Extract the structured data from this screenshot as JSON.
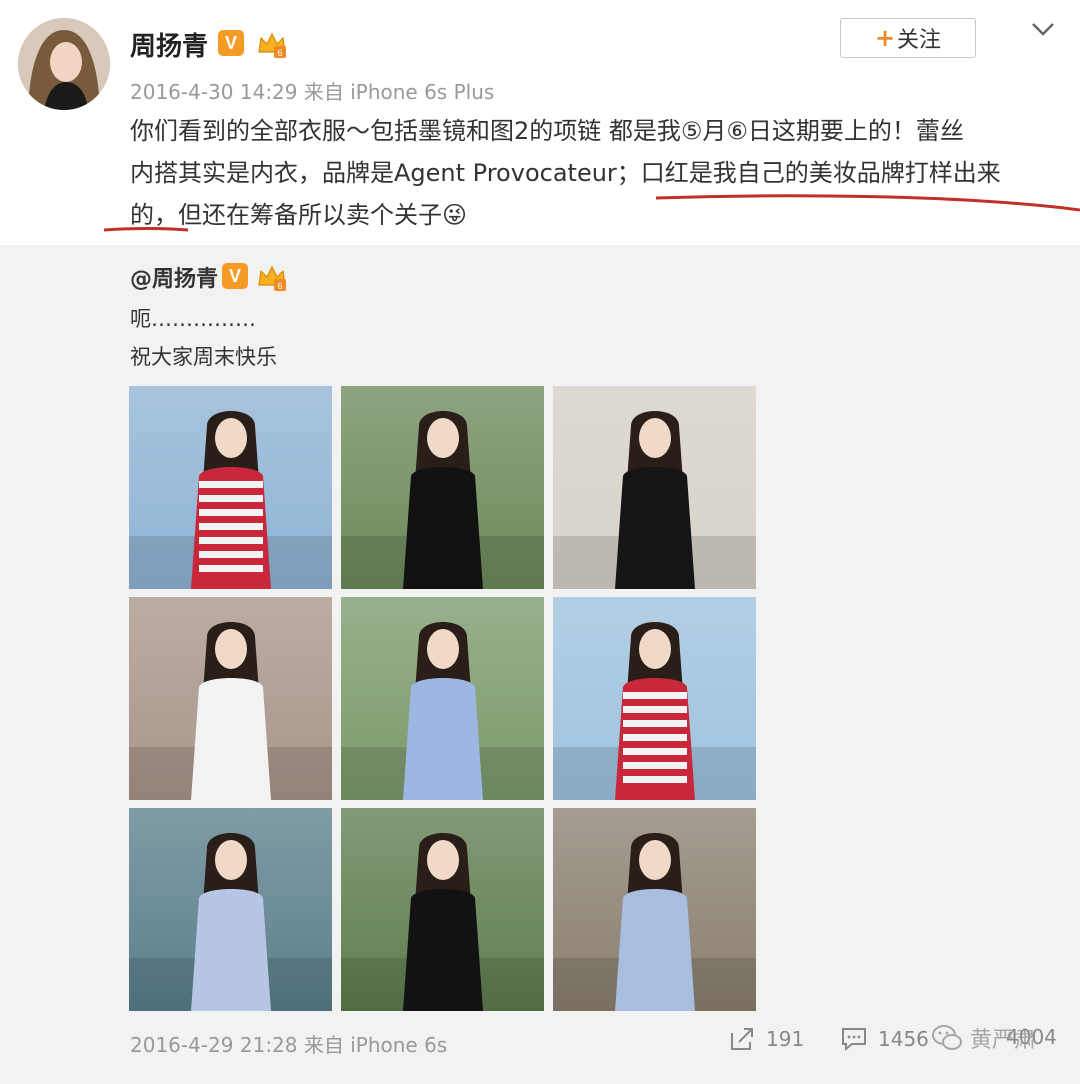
{
  "post": {
    "username": "周扬青",
    "verified_badge": "V",
    "follow_label": "关注",
    "follow_plus": "+",
    "timestamp": "2016-4-30 14:29",
    "source": "来自 iPhone 6s Plus",
    "text_line1": "你们看到的全部衣服～包括墨镜和图2的项链 都是我⑤月⑥日这期要上的！蕾丝",
    "text_line2": "内搭其实是内衣，品牌是Agent Provocateur；口红是我自己的美妆品牌打样出来",
    "text_line3": "的，但还在筹备所以卖个关子😜"
  },
  "repost": {
    "username": "@周扬青",
    "verified_badge": "V",
    "line1": "呃……………",
    "line2": "祝大家周末快乐",
    "timestamp": "2016-4-29 21:28",
    "source": "来自 iPhone 6s",
    "share_count": "191",
    "comment_count": "1456",
    "like_count": "4004",
    "watermark": "黄严肃"
  },
  "photos": [
    {
      "name": "photo-striped-dress-hat-pool",
      "colors": {
        "bg": "#8fb4d6",
        "dress": "#c8283a"
      }
    },
    {
      "name": "photo-polka-dot-dress",
      "colors": {
        "bg": "#6d8a5b",
        "dress": "#111111"
      }
    },
    {
      "name": "photo-black-dress-sunglasses",
      "colors": {
        "bg": "#d7d2c9",
        "dress": "#151515"
      }
    },
    {
      "name": "photo-white-top-selfie",
      "colors": {
        "bg": "#a9958a",
        "dress": "#f2f2f2"
      }
    },
    {
      "name": "photo-black-hat-blue-shirt",
      "colors": {
        "bg": "#7b9a6a",
        "dress": "#9db7e2"
      }
    },
    {
      "name": "photo-striped-dress-hat-railing",
      "colors": {
        "bg": "#9ec3e0",
        "dress": "#c8283a"
      }
    },
    {
      "name": "photo-sitting-teddy-bear",
      "colors": {
        "bg": "#5a7f8c",
        "dress": "#b7c6e4"
      }
    },
    {
      "name": "photo-black-top-terrace",
      "colors": {
        "bg": "#5e7d4f",
        "dress": "#121212"
      }
    },
    {
      "name": "photo-blue-shirt-balcony",
      "colors": {
        "bg": "#8a8070",
        "dress": "#a8bde0"
      }
    }
  ],
  "icons": {
    "share": "share-icon",
    "comment": "comment-icon",
    "chevron": "chevron-down-icon",
    "crown": "crown-icon"
  }
}
